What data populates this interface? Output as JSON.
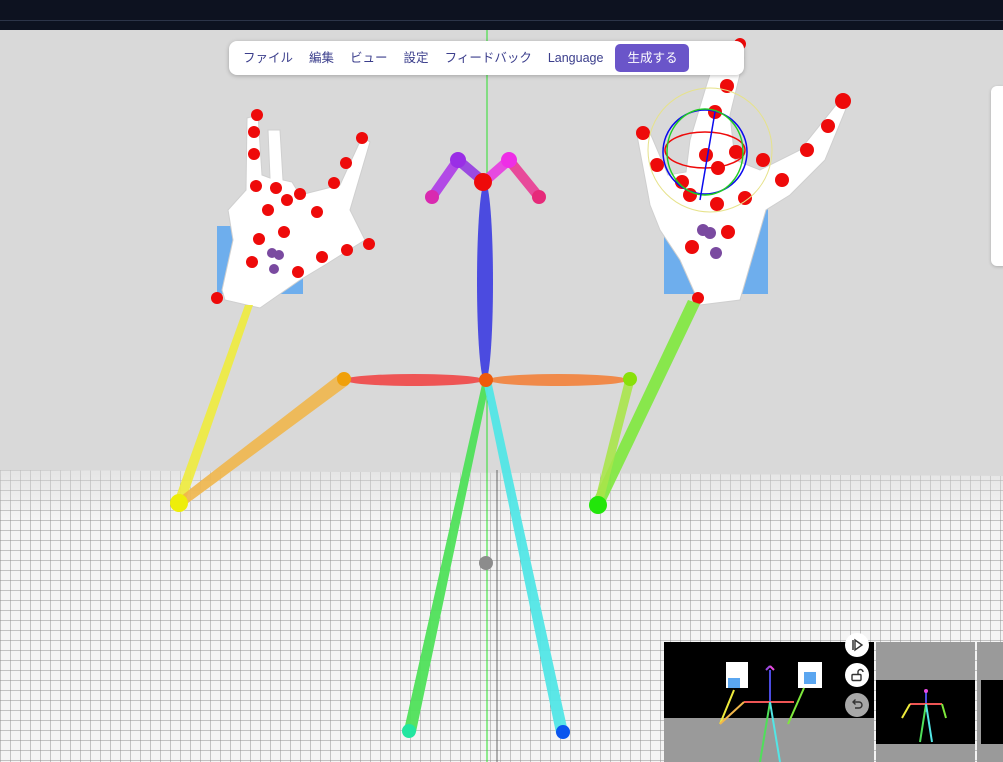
{
  "menu": {
    "items": [
      {
        "label": "ファイル"
      },
      {
        "label": "編集"
      },
      {
        "label": "ビュー"
      },
      {
        "label": "設定"
      },
      {
        "label": "フィードバック"
      },
      {
        "label": "Language"
      }
    ],
    "generate_label": "生成する"
  },
  "colors": {
    "accent": "#6a55c9",
    "background": "#d9d9d9",
    "topbar": "#0d1220",
    "joint": "#ff0000"
  },
  "controls": {
    "play_icon": "play-step-icon",
    "lock_icon": "unlock-icon",
    "undo_icon": "undo-icon"
  }
}
